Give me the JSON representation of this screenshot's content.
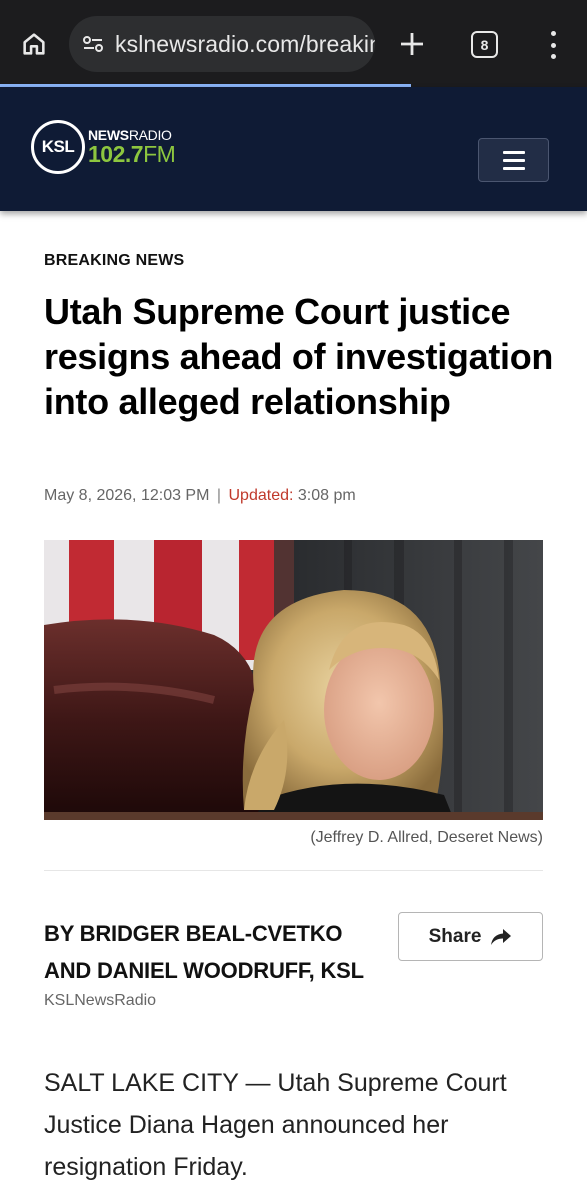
{
  "browser": {
    "url": "kslnewsradio.com/breaking-news/",
    "tab_count": "8",
    "load_progress": 0.7
  },
  "site": {
    "logo_call": "KSL",
    "logo_news": "NEWS",
    "logo_radio": "RADIO",
    "logo_freq_num": "102.7",
    "logo_freq_unit": "FM",
    "brand_color": "#0f1b35",
    "accent_color": "#8dc63f"
  },
  "article": {
    "kicker": "BREAKING NEWS",
    "headline": "Utah Supreme Court justice resigns ahead of investigation into alleged relationship",
    "date": "May 8, 2026, 12:03 PM",
    "separator": "|",
    "updated_label": "Updated:",
    "updated_time": "3:08 pm",
    "photo_caption": "(Jeffrey D. Allred, Deseret News)",
    "byline": "BY BRIDGER BEAL-CVETKO AND DANIEL WOODRUFF, KSL",
    "source": "KSLNewsRadio",
    "share_label": "Share",
    "lede": "SALT LAKE CITY — Utah Supreme Court Justice Diana Hagen announced her resignation Friday."
  },
  "icons": {
    "home": "home-icon",
    "site_settings": "site-settings-icon",
    "new_tab": "plus-icon",
    "menu": "hamburger-menu-icon",
    "share": "share-arrow-icon",
    "overflow": "more-vert-icon"
  }
}
